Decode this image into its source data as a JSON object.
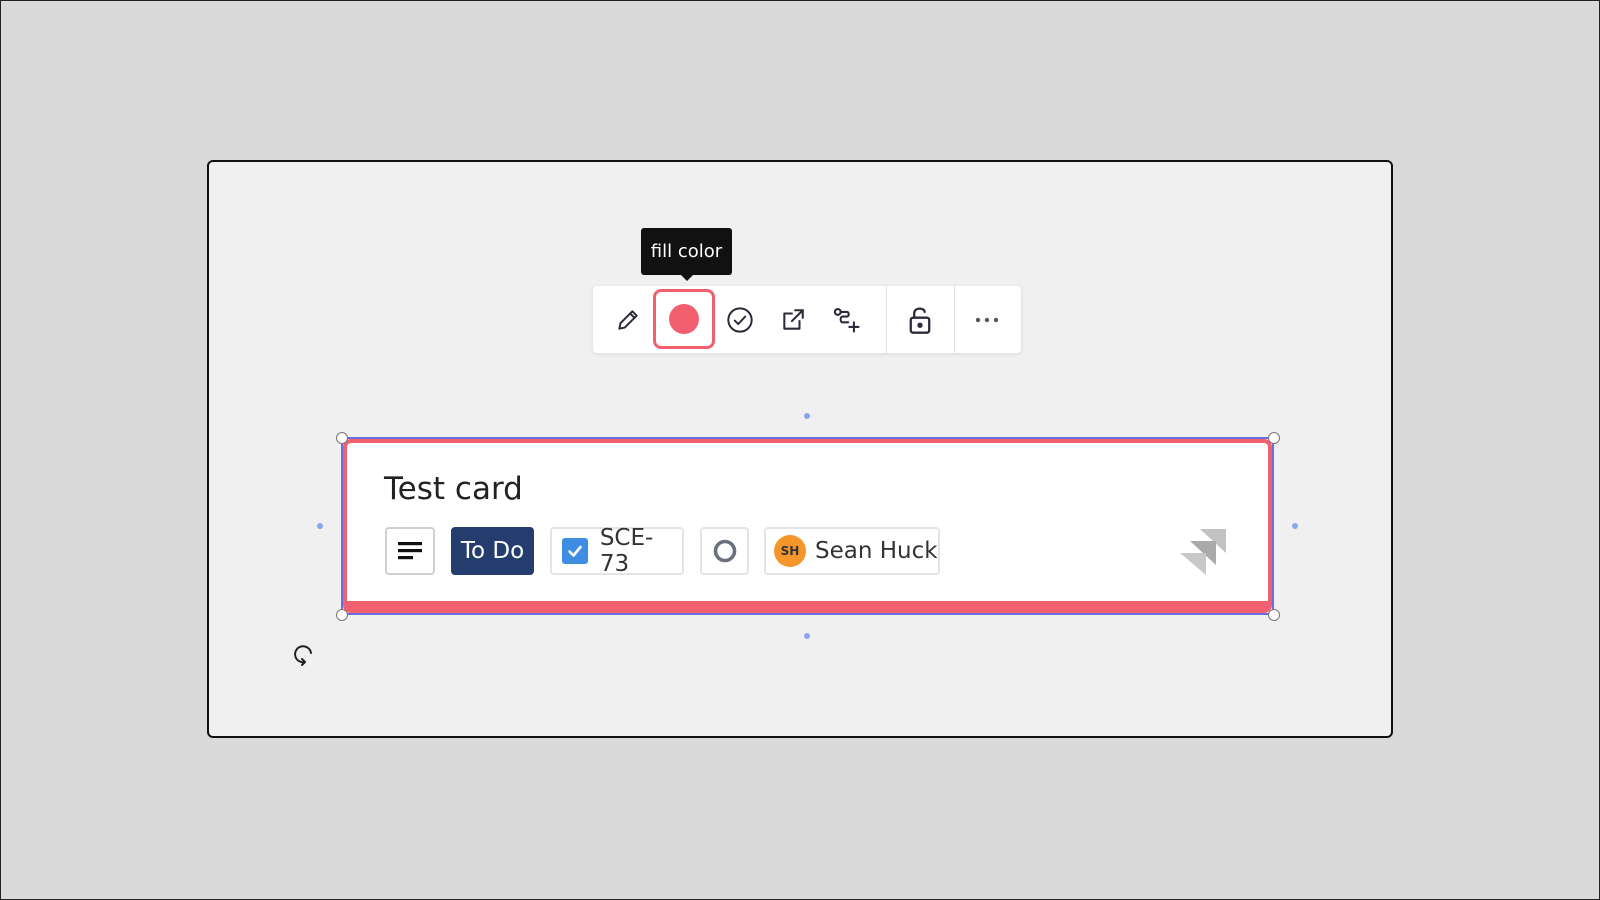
{
  "tooltip": {
    "text": "fill color"
  },
  "toolbar": {
    "items": [
      {
        "name": "edit",
        "icon": "pencil-icon"
      },
      {
        "name": "fill-color",
        "icon": "filled-circle-icon",
        "color": "#f25f6f",
        "active": true
      },
      {
        "name": "mark-done",
        "icon": "check-circle-icon"
      },
      {
        "name": "open-link",
        "icon": "external-link-icon"
      },
      {
        "name": "add-connector",
        "icon": "connector-plus-icon"
      },
      {
        "name": "lock",
        "icon": "unlock-icon"
      },
      {
        "name": "more",
        "icon": "ellipsis-icon"
      }
    ]
  },
  "card": {
    "title": "Test card",
    "fill_color": "#f25f6f",
    "description_icon": "description-lines-icon",
    "status": "To Do",
    "status_color": "#243d6e",
    "issue_key": "SCE-73",
    "issue_type_icon": "task-checkbox-icon",
    "priority_icon": "priority-circle-icon",
    "assignee": {
      "initials": "SH",
      "name": "Sean Huck",
      "avatar_color": "#f5962a"
    },
    "integration_icon": "jira-logo-icon"
  },
  "selection": {
    "color": "#6a6fe0",
    "handle_color": "#8aa4f0"
  }
}
